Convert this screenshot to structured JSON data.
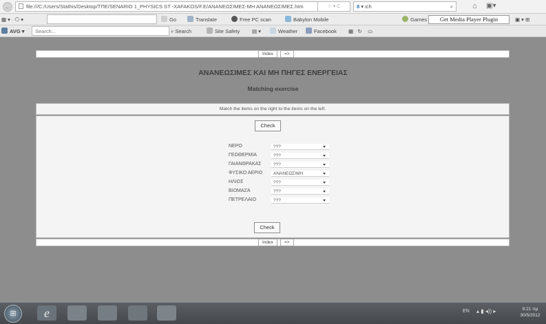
{
  "browser": {
    "address": "file:///C:/Users/Stathis/Desktop/ΤΠΕ/SENARIO 1_PHYSICS ST -XAFAKOS/F.E/ΑΝΑΝΕΩΣΙΜΕΣ-ΜΗ ΑΝΑΝΕΩΣΙΜΕΣ.htm",
    "search_value": "ιch",
    "popup_text": "Get Media Player Plugin",
    "toolbar": {
      "go": "Go",
      "translate": "Translate",
      "free_pc_scan": "Free PC scan",
      "babylon_mobile": "Babylon Mobile",
      "games": "Games"
    },
    "avg": {
      "label": "AVG",
      "search_placeholder": "Search...",
      "search": "Search",
      "site_safety": "Site Safety",
      "weather": "Weather",
      "facebook": "Facebook"
    }
  },
  "page": {
    "nav_index": "Index",
    "nav_next": "=>",
    "title": "ΑΝΑΝΕΩΣΙΜΕΣ ΚΑΙ ΜΗ ΠΗΓΕΣ ΕΝΕΡΓΕΙΑΣ",
    "subtitle": "Matching exercise",
    "instruction": "Match the items on the right to the items on the left.",
    "check_label": "Check",
    "rows": [
      {
        "label": "ΝΕΡΟ",
        "value": "???"
      },
      {
        "label": "ΓΕΩΘΕΡΜΙΑ",
        "value": "???"
      },
      {
        "label": "ΓΑΙΑΝΘΡΑΚΑΣ",
        "value": "???"
      },
      {
        "label": "ΦΥΣΙΚΟ ΑΕΡΙΟ",
        "value": "ΑΝΑΝΕΩΣΙΜΗ"
      },
      {
        "label": "ΗΛΙΟΣ",
        "value": "???"
      },
      {
        "label": "ΒΙΟΜΑΖΑ",
        "value": "???"
      },
      {
        "label": "ΠΕΤΡΕΛΑΙΟ",
        "value": "???"
      }
    ]
  },
  "taskbar": {
    "lang": "EN",
    "time": "9:21 πμ",
    "date": "30/5/2012"
  }
}
